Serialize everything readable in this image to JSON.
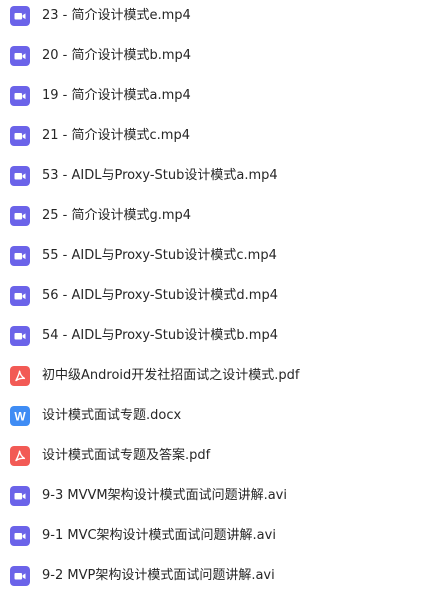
{
  "files": [
    {
      "name": "23 - 简介设计模式e.mp4",
      "icon": "video-file-icon",
      "type": "video",
      "color": "#6B63E9"
    },
    {
      "name": "20 - 简介设计模式b.mp4",
      "icon": "video-file-icon",
      "type": "video",
      "color": "#6B63E9"
    },
    {
      "name": "19 - 简介设计模式a.mp4",
      "icon": "video-file-icon",
      "type": "video",
      "color": "#6B63E9"
    },
    {
      "name": "21 - 简介设计模式c.mp4",
      "icon": "video-file-icon",
      "type": "video",
      "color": "#6B63E9"
    },
    {
      "name": "53 - AIDL与Proxy-Stub设计模式a.mp4",
      "icon": "video-file-icon",
      "type": "video",
      "color": "#6B63E9"
    },
    {
      "name": "25 - 简介设计模式g.mp4",
      "icon": "video-file-icon",
      "type": "video",
      "color": "#6B63E9"
    },
    {
      "name": "55 - AIDL与Proxy-Stub设计模式c.mp4",
      "icon": "video-file-icon",
      "type": "video",
      "color": "#6B63E9"
    },
    {
      "name": "56 - AIDL与Proxy-Stub设计模式d.mp4",
      "icon": "video-file-icon",
      "type": "video",
      "color": "#6B63E9"
    },
    {
      "name": "54 - AIDL与Proxy-Stub设计模式b.mp4",
      "icon": "video-file-icon",
      "type": "video",
      "color": "#6B63E9"
    },
    {
      "name": "初中级Android开发社招面试之设计模式.pdf",
      "icon": "pdf-file-icon",
      "type": "pdf",
      "color": "#F25A55"
    },
    {
      "name": "设计模式面试专题.docx",
      "icon": "word-file-icon",
      "type": "word",
      "color": "#3F8CF4"
    },
    {
      "name": "设计模式面试专题及答案.pdf",
      "icon": "pdf-file-icon",
      "type": "pdf",
      "color": "#F25A55"
    },
    {
      "name": "9-3 MVVM架构设计模式面试问题讲解.avi",
      "icon": "video-file-icon",
      "type": "video",
      "color": "#6B63E9"
    },
    {
      "name": "9-1 MVC架构设计模式面试问题讲解.avi",
      "icon": "video-file-icon",
      "type": "video",
      "color": "#6B63E9"
    },
    {
      "name": "9-2 MVP架构设计模式面试问题讲解.avi",
      "icon": "video-file-icon",
      "type": "video",
      "color": "#6B63E9"
    }
  ]
}
